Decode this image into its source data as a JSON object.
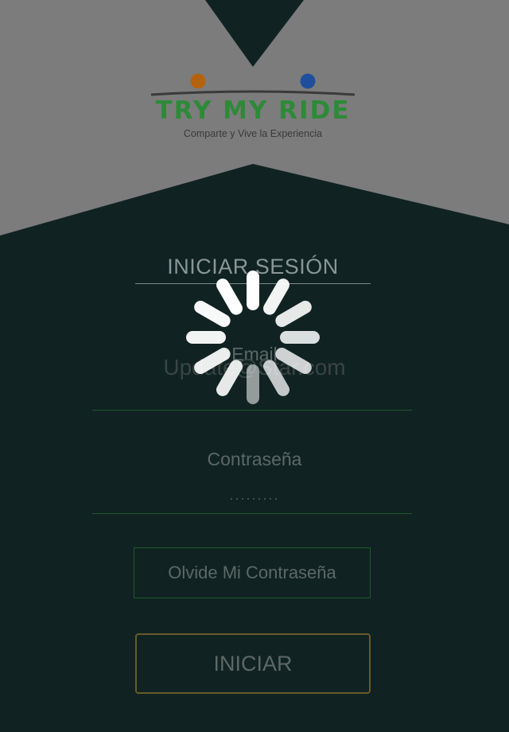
{
  "app": {
    "logo_name": "TRY MY RIDE",
    "tagline": "Comparte y Vive la Experiencia"
  },
  "login": {
    "title": "INICIAR SESIÓN",
    "email_label": "Email",
    "email_value": "Update@Star.com",
    "password_label": "Contraseña",
    "password_value": ".........",
    "forgot_label": "Olvide Mi Contraseña",
    "submit_label": "INICIAR"
  },
  "status": {
    "loading": true,
    "spinner_icon": "loading-spinner-icon"
  },
  "colors": {
    "background": "#102222",
    "header": "#7c7c7c",
    "brand_green": "#2e8a38",
    "logo_orange": "#b5620f",
    "logo_blue": "#1f4f9c",
    "field_line": "#1f5a2a",
    "button_border_gold": "#665b2a"
  }
}
